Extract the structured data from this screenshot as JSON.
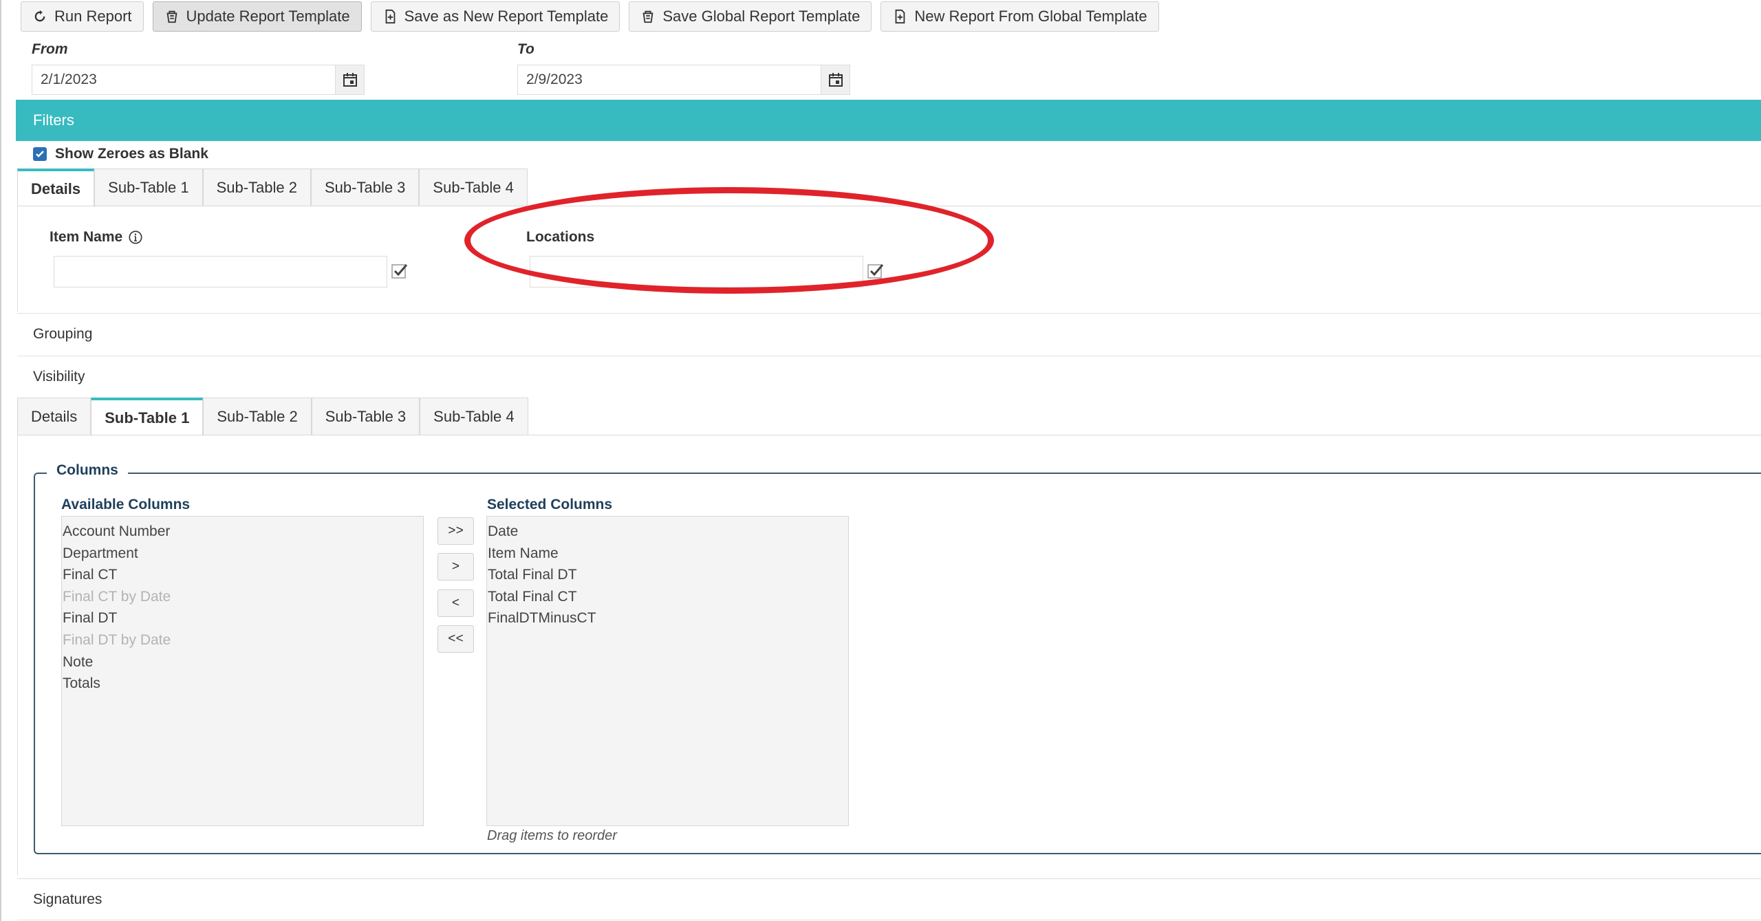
{
  "toolbar": {
    "buttons": [
      {
        "label": "Run Report",
        "icon": "refresh-icon"
      },
      {
        "label": "Update Report Template",
        "icon": "template-icon"
      },
      {
        "label": "Save as New Report Template",
        "icon": "add-file-icon"
      },
      {
        "label": "Save Global Report Template",
        "icon": "template-icon"
      },
      {
        "label": "New Report From Global Template",
        "icon": "add-file-icon"
      }
    ]
  },
  "dates": {
    "from_label": "From",
    "from_value": "2/1/2023",
    "to_label": "To",
    "to_value": "2/9/2023"
  },
  "filters": {
    "title": "Filters",
    "show_zeroes_label": "Show Zeroes as Blank",
    "show_zeroes_checked": true,
    "tabs": [
      "Details",
      "Sub-Table 1",
      "Sub-Table 2",
      "Sub-Table 3",
      "Sub-Table 4"
    ],
    "active_tab": "Details",
    "item_name_label": "Item Name",
    "item_name_value": "",
    "locations_label": "Locations",
    "locations_value": ""
  },
  "sections": {
    "grouping": "Grouping",
    "visibility": "Visibility",
    "signatures": "Signatures"
  },
  "visibility": {
    "tabs": [
      "Details",
      "Sub-Table 1",
      "Sub-Table 2",
      "Sub-Table 3",
      "Sub-Table 4"
    ],
    "active_tab": "Sub-Table 1"
  },
  "columns": {
    "legend": "Columns",
    "available_title": "Available Columns",
    "available": [
      {
        "label": "Account Number",
        "disabled": false
      },
      {
        "label": "Department",
        "disabled": false
      },
      {
        "label": "Final CT",
        "disabled": false
      },
      {
        "label": "Final CT by Date",
        "disabled": true
      },
      {
        "label": "Final DT",
        "disabled": false
      },
      {
        "label": "Final DT by Date",
        "disabled": true
      },
      {
        "label": "Note",
        "disabled": false
      },
      {
        "label": "Totals",
        "disabled": false
      }
    ],
    "selected_title": "Selected Columns",
    "selected": [
      "Date",
      "Item Name",
      "Total Final DT",
      "Total Final CT",
      "FinalDTMinusCT"
    ],
    "move_buttons": [
      ">>",
      ">",
      "<",
      "<<"
    ],
    "hint": "Drag items to reorder"
  },
  "colors": {
    "accent": "#38bbc0",
    "annotation": "#e0232a",
    "checkbox": "#2c6fb5"
  }
}
